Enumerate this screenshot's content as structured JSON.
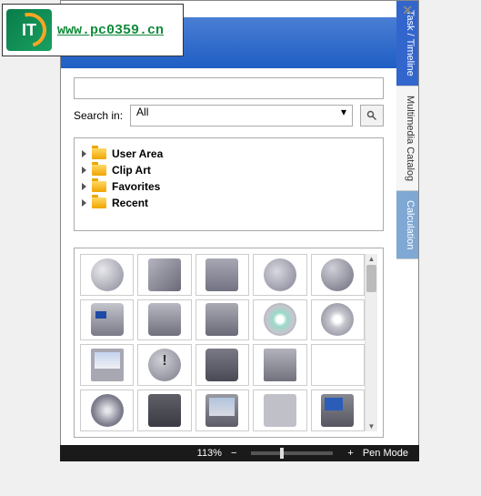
{
  "watermark": {
    "url": "www.pc0359.cn",
    "logo_text": "IT"
  },
  "sidebar": {
    "tabs": [
      {
        "label": "Task / Timeline",
        "key": "task"
      },
      {
        "label": "Multimedia Catalog",
        "key": "catalog"
      },
      {
        "label": "Calculation",
        "key": "calc"
      }
    ]
  },
  "search": {
    "value": "",
    "in_label": "Search in:",
    "select_value": "All"
  },
  "tree": {
    "items": [
      {
        "label": "User Area"
      },
      {
        "label": "Clip Art"
      },
      {
        "label": "Favorites"
      },
      {
        "label": "Recent"
      }
    ]
  },
  "catalog": {
    "items": [
      {
        "name": "globe-icon",
        "cls": "ic-globe"
      },
      {
        "name": "book-icon",
        "cls": "ic-book"
      },
      {
        "name": "books-icon",
        "cls": "ic-books"
      },
      {
        "name": "mail-at-icon",
        "cls": "ic-mail"
      },
      {
        "name": "earth-icon",
        "cls": "ic-earth"
      },
      {
        "name": "camcorder-icon",
        "cls": "ic-camcorder"
      },
      {
        "name": "compact-camera-icon",
        "cls": "ic-camera"
      },
      {
        "name": "photo-stack-icon",
        "cls": "ic-photos"
      },
      {
        "name": "cd-icon",
        "cls": "ic-cd"
      },
      {
        "name": "disc-icon",
        "cls": "ic-disc"
      },
      {
        "name": "monitor-icon",
        "cls": "ic-monitor"
      },
      {
        "name": "warning-icon",
        "cls": "ic-warn"
      },
      {
        "name": "slr-camera-icon",
        "cls": "ic-slr"
      },
      {
        "name": "floppy-icon",
        "cls": "ic-floppy"
      },
      {
        "name": "drive-icon",
        "cls": "ic-drive"
      },
      {
        "name": "speaker-icon",
        "cls": "ic-speaker"
      },
      {
        "name": "stereo-icon",
        "cls": "ic-stereo"
      },
      {
        "name": "tv-icon",
        "cls": "ic-tv"
      },
      {
        "name": "tools-icon",
        "cls": "ic-tools"
      },
      {
        "name": "media-player-icon",
        "cls": "ic-player"
      }
    ]
  },
  "status": {
    "zoom": "113%",
    "minus": "−",
    "plus": "+",
    "mode": "Pen Mode"
  }
}
